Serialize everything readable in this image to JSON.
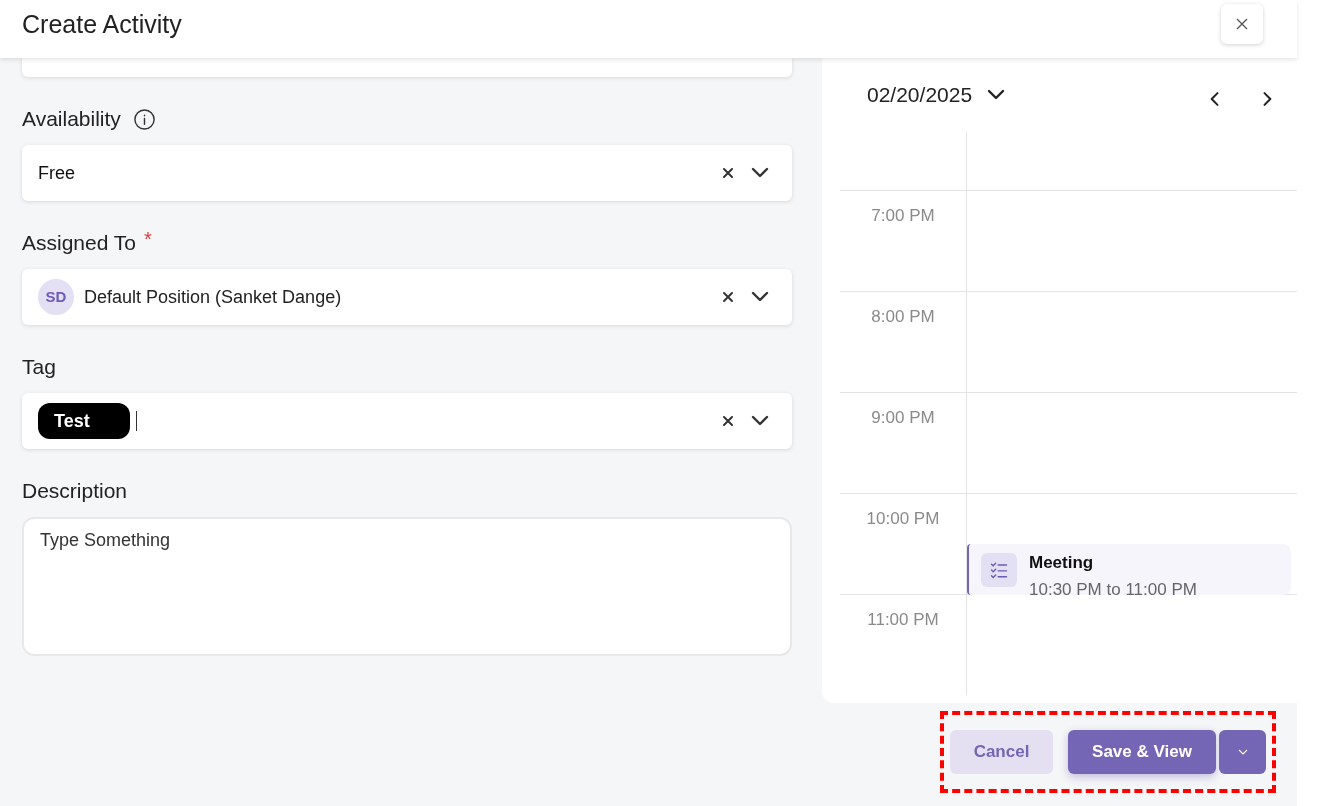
{
  "header": {
    "title": "Create Activity"
  },
  "form": {
    "fields": [
      {
        "kind": "select",
        "label": "Availability",
        "info": true,
        "value": "Free"
      },
      {
        "kind": "person",
        "label": "Assigned To",
        "info": false,
        "required_mark": "*",
        "initials": "SD",
        "value": "Default Position (Sanket Dange)"
      },
      {
        "kind": "tags",
        "label": "Tag",
        "info": false,
        "tags": [
          "Test"
        ]
      },
      {
        "kind": "textarea",
        "label": "Description",
        "info": false,
        "placeholder": "Type Something"
      }
    ]
  },
  "calendar": {
    "date": "02/20/2025",
    "hours": [
      {
        "label": "7:00 PM"
      },
      {
        "label": "8:00 PM"
      },
      {
        "label": "9:00 PM"
      },
      {
        "label": "10:00 PM",
        "events": [
          {
            "title": "Meeting",
            "time": "10:30 PM to 11:00 PM"
          }
        ]
      },
      {
        "label": "11:00 PM"
      }
    ]
  },
  "footer": {
    "highlighted": true,
    "buttons": [
      {
        "kind": "secondary",
        "label": "Cancel"
      },
      {
        "kind": "primary",
        "label": "Save & View"
      },
      {
        "kind": "menu"
      }
    ]
  }
}
